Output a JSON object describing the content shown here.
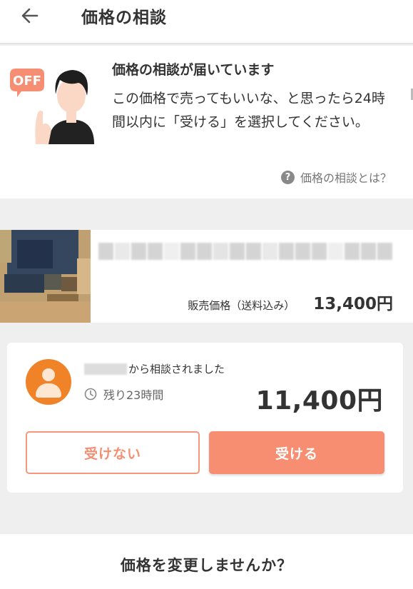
{
  "header": {
    "title": "価格の相談"
  },
  "notice": {
    "badge": "OFF",
    "title": "価格の相談が届いています",
    "body": "この価格で売ってもいいな、と思ったら24時間以内に「受ける」を選択してください。",
    "help_link": "価格の相談とは？"
  },
  "product": {
    "price_label": "販売価格（送料込み）",
    "price": "13,400円"
  },
  "offer": {
    "from_suffix": "から相談されました",
    "remaining": "残り23時間",
    "price": "11,400円",
    "decline_label": "受けない",
    "accept_label": "受ける"
  },
  "footer": {
    "change_prompt": "価格を変更しませんか？"
  },
  "colors": {
    "accent": "#f78d71",
    "avatar": "#f08228",
    "background": "#efefef"
  }
}
